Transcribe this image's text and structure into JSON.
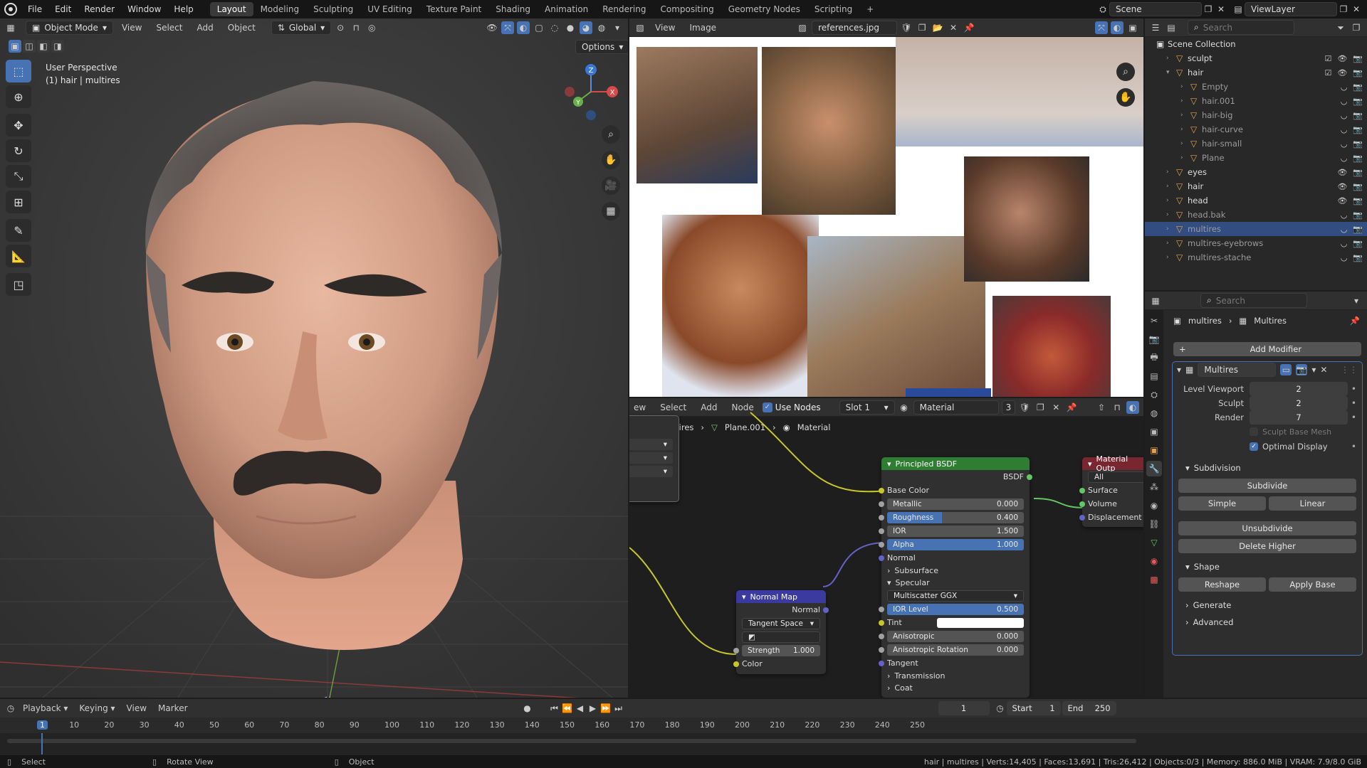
{
  "topbar": {
    "menus": [
      "File",
      "Edit",
      "Render",
      "Window",
      "Help"
    ],
    "workspaces": [
      "Layout",
      "Modeling",
      "Sculpting",
      "UV Editing",
      "Texture Paint",
      "Shading",
      "Animation",
      "Rendering",
      "Compositing",
      "Geometry Nodes",
      "Scripting"
    ],
    "active_workspace": "Layout",
    "add_workspace": "+",
    "scene": "Scene",
    "view_layer": "ViewLayer"
  },
  "viewport": {
    "mode": "Object Mode",
    "menus": [
      "View",
      "Select",
      "Add",
      "Object"
    ],
    "orientation": "Global",
    "options": "Options",
    "info_line1": "User Perspective",
    "info_line2": "(1) hair | multires",
    "gizmo": {
      "x": "X",
      "y": "Y",
      "z": "Z"
    }
  },
  "image_editor": {
    "menus": [
      "View",
      "Image"
    ],
    "image_name": "references.jpg"
  },
  "node_editor": {
    "menus": [
      "ew",
      "Select",
      "Add",
      "Node"
    ],
    "use_nodes_label": "Use Nodes",
    "slot": "Slot 1",
    "material": "Material",
    "users": "3",
    "breadcrumb": [
      "multires",
      "Plane.001",
      "Material"
    ],
    "principled": {
      "title": "Principled BSDF",
      "output": "BSDF",
      "base_color": "Base Color",
      "fields": [
        {
          "label": "Metallic",
          "value": "0.000",
          "highlight": false
        },
        {
          "label": "Roughness",
          "value": "0.400",
          "highlight": true
        },
        {
          "label": "IOR",
          "value": "1.500",
          "highlight": false
        },
        {
          "label": "Alpha",
          "value": "1.000",
          "highlight": true
        }
      ],
      "normal": "Normal",
      "subsurface": "Subsurface",
      "specular": "Specular",
      "distribution": "Multiscatter GGX",
      "ior_level": {
        "label": "IOR Level",
        "value": "0.500"
      },
      "tint": "Tint",
      "anisotropic": {
        "label": "Anisotropic",
        "value": "0.000"
      },
      "aniso_rot": {
        "label": "Anisotropic Rotation",
        "value": "0.000"
      },
      "tangent": "Tangent",
      "transmission": "Transmission",
      "coat": "Coat"
    },
    "output_node": {
      "title": "Material Outp",
      "target": "All",
      "sockets": [
        "Surface",
        "Volume",
        "Displacement"
      ]
    },
    "normal_map": {
      "title": "Normal Map",
      "output": "Normal",
      "space": "Tangent Space",
      "strength_label": "Strength",
      "strength": "1.000",
      "color": "Color"
    }
  },
  "outliner": {
    "search_placeholder": "Search",
    "root": "Scene Collection",
    "items": [
      {
        "name": "sculpt",
        "depth": 0,
        "open": false,
        "vis": true,
        "sel": false
      },
      {
        "name": "hair",
        "depth": 0,
        "open": true,
        "vis": true,
        "sel": false
      },
      {
        "name": "Empty",
        "depth": 1,
        "open": false,
        "vis": false,
        "sel": false
      },
      {
        "name": "hair.001",
        "depth": 1,
        "open": false,
        "vis": false,
        "sel": false
      },
      {
        "name": "hair-big",
        "depth": 1,
        "open": false,
        "vis": false,
        "sel": false
      },
      {
        "name": "hair-curve",
        "depth": 1,
        "open": false,
        "vis": false,
        "sel": false
      },
      {
        "name": "hair-small",
        "depth": 1,
        "open": false,
        "vis": false,
        "sel": false
      },
      {
        "name": "Plane",
        "depth": 1,
        "open": false,
        "vis": false,
        "sel": false
      },
      {
        "name": "eyes",
        "depth": 0,
        "open": false,
        "vis": true,
        "sel": false
      },
      {
        "name": "hair",
        "depth": 0,
        "open": false,
        "vis": true,
        "sel": false
      },
      {
        "name": "head",
        "depth": 0,
        "open": false,
        "vis": true,
        "sel": false
      },
      {
        "name": "head.bak",
        "depth": 0,
        "open": false,
        "vis": false,
        "sel": false
      },
      {
        "name": "multires",
        "depth": 0,
        "open": false,
        "vis": false,
        "sel": true
      },
      {
        "name": "multires-eyebrows",
        "depth": 0,
        "open": false,
        "vis": false,
        "sel": false
      },
      {
        "name": "multires-stache",
        "depth": 0,
        "open": false,
        "vis": false,
        "sel": false
      }
    ]
  },
  "properties": {
    "search_placeholder": "Search",
    "breadcrumb": [
      "multires",
      "Multires"
    ],
    "add_modifier": "Add Modifier",
    "modifier_name": "Multires",
    "levels": [
      {
        "label": "Level Viewport",
        "value": "2"
      },
      {
        "label": "Sculpt",
        "value": "2"
      },
      {
        "label": "Render",
        "value": "7"
      }
    ],
    "sculpt_base_mesh": "Sculpt Base Mesh",
    "optimal_display": "Optimal Display",
    "subdivision": "Subdivision",
    "subdivide": "Subdivide",
    "simple": "Simple",
    "linear": "Linear",
    "unsubdivide": "Unsubdivide",
    "delete_higher": "Delete Higher",
    "shape": "Shape",
    "reshape": "Reshape",
    "apply_base": "Apply Base",
    "generate": "Generate",
    "advanced": "Advanced"
  },
  "timeline": {
    "menus": [
      "Playback",
      "Keying",
      "View",
      "Marker"
    ],
    "current_frame": "1",
    "start_label": "Start",
    "start": "1",
    "end_label": "End",
    "end": "250",
    "ticks": [
      "1",
      "10",
      "20",
      "30",
      "40",
      "50",
      "60",
      "70",
      "80",
      "90",
      "100",
      "110",
      "120",
      "130",
      "140",
      "150",
      "160",
      "170",
      "180",
      "190",
      "200",
      "210",
      "220",
      "230",
      "240",
      "250"
    ]
  },
  "statusbar": {
    "select": "Select",
    "rotate": "Rotate View",
    "object": "Object",
    "stats": "hair | multires | Verts:14,405 | Faces:13,691 | Tris:26,412 | Objects:0/3 | Memory: 886.0 MiB | VRAM: 7.9/8.0 GiB"
  },
  "colors": {
    "accent": "#4772b3",
    "shader_header": "#2f7d32",
    "vector_header": "#3b3aa0",
    "output_header": "#7a2630",
    "socket_yellow": "#c7c729",
    "socket_green": "#63c763",
    "socket_gray": "#a1a1a1",
    "socket_purple": "#6363c7",
    "object_orange": "#e8a048"
  }
}
